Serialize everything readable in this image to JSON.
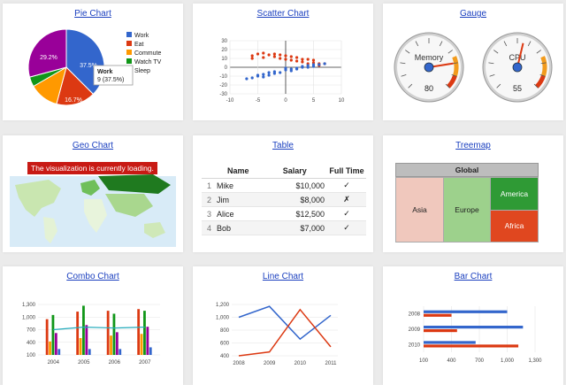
{
  "cards": {
    "pie": "Pie Chart",
    "scatter": "Scatter Chart",
    "gauge": "Gauge",
    "geo": "Geo Chart",
    "table": "Table",
    "treemap": "Treemap",
    "combo": "Combo Chart",
    "line": "Line Chart",
    "bar": "Bar Chart"
  },
  "geo": {
    "loading_text": "The visualization is currently loading."
  },
  "table": {
    "headers": [
      "Name",
      "Salary",
      "Full Time"
    ],
    "rows": [
      {
        "idx": "1",
        "name": "Mike",
        "salary": "$10,000",
        "full_time": "✓"
      },
      {
        "idx": "2",
        "name": "Jim",
        "salary": "$8,000",
        "full_time": "✗"
      },
      {
        "idx": "3",
        "name": "Alice",
        "salary": "$12,500",
        "full_time": "✓"
      },
      {
        "idx": "4",
        "name": "Bob",
        "salary": "$7,000",
        "full_time": "✓"
      }
    ]
  },
  "treemap": {
    "root": "Global",
    "cells": [
      {
        "label": "Asia",
        "color": "#f0c8bd"
      },
      {
        "label": "Europe",
        "color": "#9dd18c"
      },
      {
        "label": "America",
        "color": "#2f9a35"
      },
      {
        "label": "Africa",
        "color": "#e0471f"
      }
    ]
  },
  "colors": {
    "blue": "#3366cc",
    "red": "#dc3912",
    "orange": "#ff9900",
    "green": "#109618",
    "purple": "#990099",
    "link": "#1a3fbf"
  },
  "chart_data": [
    {
      "type": "pie",
      "title": "Pie Chart",
      "series": [
        {
          "name": "Work",
          "value": 9,
          "color": "#3366cc"
        },
        {
          "name": "Eat",
          "value": 4,
          "color": "#dc3912"
        },
        {
          "name": "Commute",
          "value": 3,
          "color": "#ff9900"
        },
        {
          "name": "Watch TV",
          "value": 1,
          "color": "#109618"
        },
        {
          "name": "Sleep",
          "value": 7,
          "color": "#990099"
        }
      ],
      "slice_labels": [
        "37.5%",
        "16.7%",
        "29.2%"
      ],
      "tooltip": {
        "title": "Work",
        "value": "9 (37.5%)"
      },
      "legend": "right"
    },
    {
      "type": "scatter",
      "title": "Scatter Chart",
      "x_ticks": [
        "-10",
        "-5",
        "0",
        "5",
        "10"
      ],
      "y_ticks": [
        "30",
        "20",
        "10",
        "0",
        "-10",
        "-20",
        "-30"
      ],
      "xlim": [
        -10,
        10
      ],
      "ylim": [
        -30,
        30
      ],
      "series": [
        {
          "color": "#dc3912",
          "points": [
            [
              -6,
              13
            ],
            [
              -5,
              15
            ],
            [
              -4,
              11
            ],
            [
              -3,
              14
            ],
            [
              -2,
              12
            ],
            [
              -1,
              10
            ],
            [
              0,
              13
            ],
            [
              1,
              8
            ],
            [
              2,
              11
            ],
            [
              3,
              6
            ],
            [
              4,
              9
            ],
            [
              5,
              5
            ],
            [
              6,
              4
            ],
            [
              -4,
              16
            ],
            [
              -2,
              15
            ],
            [
              0,
              9
            ],
            [
              2,
              7
            ],
            [
              4,
              4
            ],
            [
              -6,
              10
            ],
            [
              7,
              4
            ],
            [
              -1,
              14
            ],
            [
              1,
              12
            ],
            [
              3,
              9
            ],
            [
              5,
              8
            ],
            [
              6,
              2
            ]
          ]
        },
        {
          "color": "#3366cc",
          "points": [
            [
              -6,
              -12
            ],
            [
              -5,
              -10
            ],
            [
              -4,
              -8
            ],
            [
              -3,
              -9
            ],
            [
              -2,
              -5
            ],
            [
              -1,
              -6
            ],
            [
              0,
              -3
            ],
            [
              1,
              -4
            ],
            [
              2,
              -1
            ],
            [
              3,
              0
            ],
            [
              4,
              2
            ],
            [
              5,
              1
            ],
            [
              6,
              3
            ],
            [
              -4,
              -11
            ],
            [
              -2,
              -7
            ],
            [
              0,
              -1
            ],
            [
              2,
              -2
            ],
            [
              4,
              0
            ],
            [
              -7,
              -13
            ],
            [
              7,
              4
            ],
            [
              -3,
              -6
            ],
            [
              1,
              -2
            ],
            [
              3,
              1
            ],
            [
              5,
              3
            ],
            [
              -5,
              -9
            ]
          ]
        }
      ]
    },
    {
      "type": "gauge",
      "title": "Gauge",
      "gauges": [
        {
          "label": "Memory",
          "value": 80,
          "min": 0,
          "max": 100
        },
        {
          "label": "CPU",
          "value": 55,
          "min": 0,
          "max": 100
        }
      ]
    },
    {
      "type": "combo",
      "title": "Combo Chart",
      "categories": [
        "2004",
        "2005",
        "2006",
        "2007"
      ],
      "y_ticks": [
        "1,300",
        "1,000",
        "700",
        "400",
        "100"
      ],
      "ylim": [
        100,
        1300
      ],
      "series": [
        {
          "color": "#dc3912",
          "values": [
            950,
            1130,
            1150,
            1190
          ]
        },
        {
          "color": "#ff9900",
          "values": [
            420,
            500,
            560,
            600
          ]
        },
        {
          "color": "#109618",
          "values": [
            1050,
            1270,
            1080,
            1150
          ]
        },
        {
          "color": "#990099",
          "values": [
            620,
            810,
            640,
            770
          ]
        },
        {
          "color": "#3366cc",
          "values": [
            240,
            240,
            240,
            280
          ]
        }
      ],
      "line": {
        "color": "#22aabb",
        "values": [
          700,
          760,
          740,
          760
        ]
      }
    },
    {
      "type": "line",
      "title": "Line Chart",
      "categories": [
        "2008",
        "2009",
        "2010",
        "2011"
      ],
      "y_ticks": [
        "1,200",
        "1,000",
        "800",
        "600",
        "400"
      ],
      "ylim": [
        400,
        1200
      ],
      "series": [
        {
          "color": "#3366cc",
          "values": [
            1000,
            1170,
            660,
            1030
          ]
        },
        {
          "color": "#dc3912",
          "values": [
            400,
            460,
            1120,
            540
          ]
        }
      ]
    },
    {
      "type": "bar",
      "title": "Bar Chart",
      "categories": [
        "2008",
        "2009",
        "2010"
      ],
      "x_ticks": [
        "100",
        "400",
        "700",
        "1,000",
        "1,300"
      ],
      "xlim": [
        100,
        1300
      ],
      "series": [
        {
          "color": "#3366cc",
          "values": [
            1000,
            1170,
            660
          ]
        },
        {
          "color": "#dc3912",
          "values": [
            400,
            460,
            1120
          ]
        }
      ]
    }
  ]
}
